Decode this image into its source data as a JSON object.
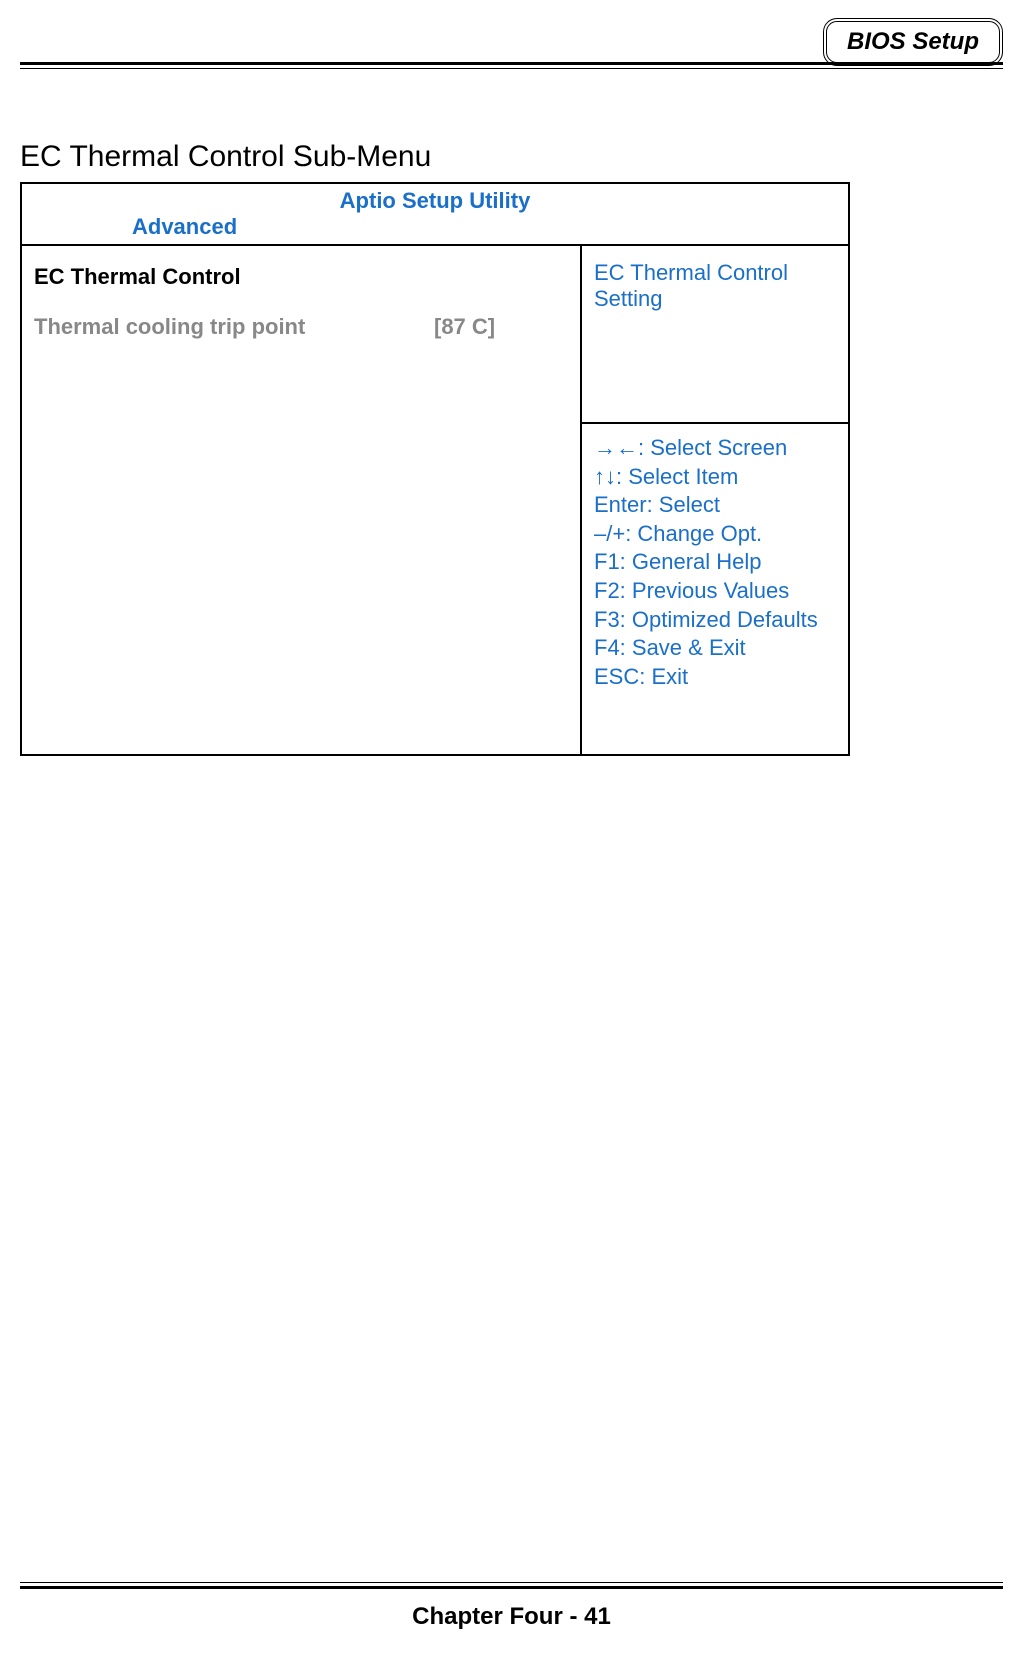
{
  "header": {
    "badge": "BIOS Setup"
  },
  "section": {
    "title": "EC Thermal Control Sub-Menu"
  },
  "bios": {
    "utility_title": "Aptio Setup Utility",
    "active_tab": "Advanced",
    "left": {
      "panel_title": "EC Thermal Control",
      "setting_label": "Thermal cooling trip point",
      "setting_value": "[87 C]"
    },
    "help": "EC Thermal Control Setting",
    "keys": [
      "→←: Select Screen",
      "↑↓: Select Item",
      "Enter: Select",
      "–/+: Change Opt.",
      "F1: General Help",
      "F2: Previous Values",
      "F3: Optimized Defaults",
      "F4: Save & Exit",
      "ESC: Exit"
    ]
  },
  "footer": {
    "text": "Chapter Four - 41"
  }
}
